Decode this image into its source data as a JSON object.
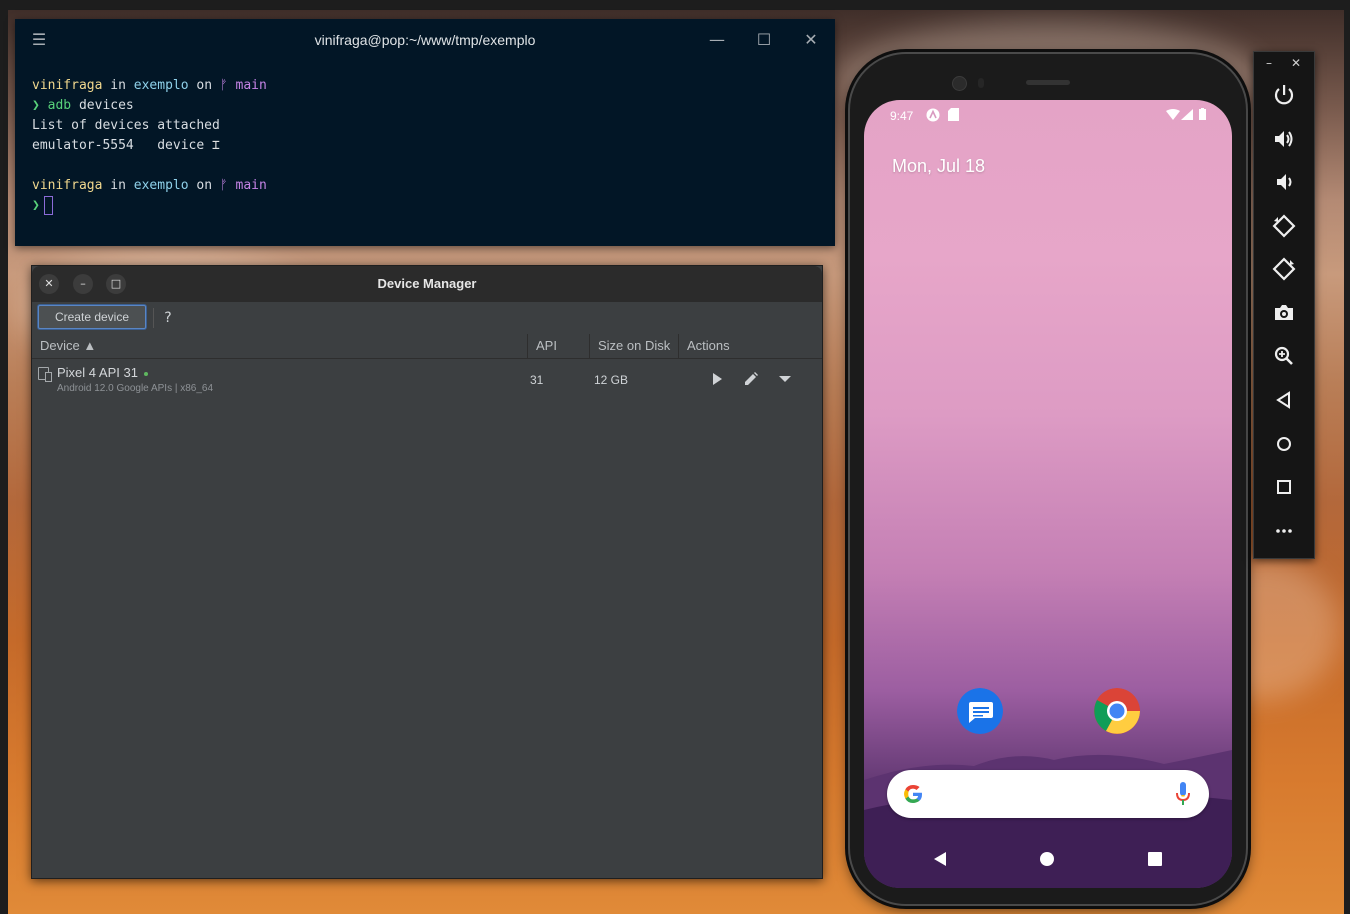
{
  "terminal": {
    "title": "vinifraga@pop:~/www/tmp/exemplo",
    "user": "vinifraga",
    "in_word": " in ",
    "dir": "exemplo",
    "on_word": " on ",
    "branch_glyph": "ᚠ",
    "branch": "main",
    "prompt": "❯",
    "command": "adb",
    "command_arg": "devices",
    "output_line1": "List of devices attached",
    "output_line2": "emulator-5554   device",
    "controls": {
      "menu": "☰",
      "minimize": "—",
      "maximize": "☐",
      "close": "✕"
    }
  },
  "device_manager": {
    "title": "Device Manager",
    "window_controls": {
      "close": "✕",
      "minimize": "–",
      "maximize": "□"
    },
    "create_button": "Create device",
    "help_button": "?",
    "columns": {
      "device": "Device ▲",
      "api": "API",
      "size": "Size on Disk",
      "actions": "Actions"
    },
    "devices": [
      {
        "name": "Pixel 4 API 31",
        "subtitle": "Android 12.0 Google APIs | x86_64",
        "api": "31",
        "size": "12 GB"
      }
    ]
  },
  "phone": {
    "status_time": "9:47",
    "date": "Mon, Jul 18",
    "apps": [
      "messages-app",
      "chrome-app"
    ],
    "colors": {
      "wallpaper_top": "#e4a3c6",
      "wallpaper_bottom": "#3d1f52",
      "messages": "#1a73e8"
    }
  },
  "emulator_toolbar": {
    "minimize": "–",
    "close": "✕",
    "buttons": [
      "power",
      "volume-up",
      "volume-down",
      "rotate-left",
      "rotate-right",
      "screenshot",
      "zoom",
      "back",
      "home",
      "overview",
      "more"
    ]
  }
}
